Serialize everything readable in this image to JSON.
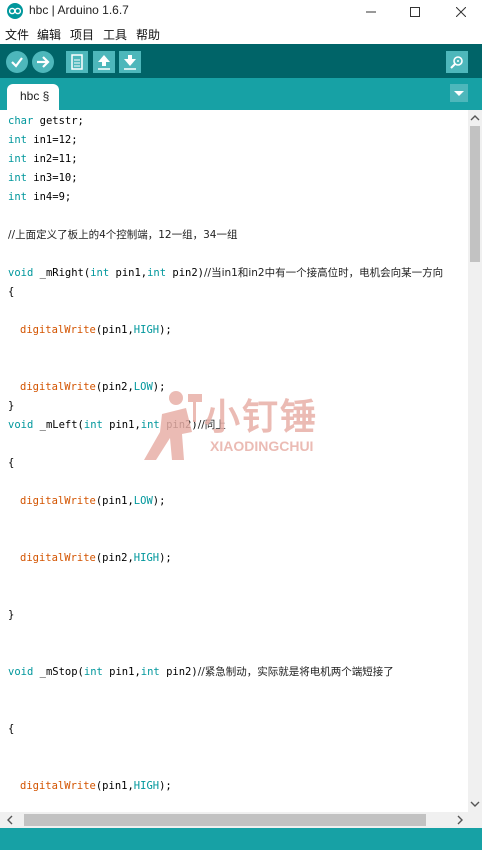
{
  "window": {
    "title": "hbc | Arduino 1.6.7",
    "minimize_icon": "minimize-icon",
    "maximize_icon": "maximize-icon",
    "close_icon": "close-icon"
  },
  "menu": {
    "items": [
      "文件",
      "编辑",
      "项目",
      "工具",
      "帮助"
    ]
  },
  "toolbar": {
    "buttons": [
      "verify-icon",
      "upload-icon",
      "new-icon",
      "open-icon",
      "save-icon"
    ],
    "serial_monitor": "serial-monitor-icon"
  },
  "tabs": [
    {
      "label": "hbc §"
    }
  ],
  "code": {
    "l1_kw": "char",
    "l1_rest": " getstr;",
    "l2_kw": "int",
    "l2_rest": " in1=12;",
    "l3_kw": "int",
    "l3_rest": " in2=11;",
    "l4_kw": "int",
    "l4_rest": " in3=10;",
    "l5_kw": "int",
    "l5_rest": " in4=9;",
    "l6": "//上面定义了板上的4个控制端，12一组，34一组",
    "l7_void": "void",
    "l7_name": " _mRight(",
    "l7_int1": "int",
    "l7_p1": " pin1,",
    "l7_int2": "int",
    "l7_p2": " pin2)",
    "l7_cm": "//当in1和in2中有一个接高位时，电机会向某一方向",
    "l8": "{",
    "l9_fn": "digitalWrite",
    "l9_a": "(pin1,",
    "l9_c": "HIGH",
    "l9_e": ");",
    "l10_fn": "digitalWrite",
    "l10_a": "(pin2,",
    "l10_c": "LOW",
    "l10_e": ");",
    "l11": "}",
    "l12_void": "void",
    "l12_name": " _mLeft(",
    "l12_int1": "int",
    "l12_p1": " pin1,",
    "l12_int2": "int",
    "l12_p2": " pin2)",
    "l12_cm": "//同上",
    "l13": "{",
    "l14_fn": "digitalWrite",
    "l14_a": "(pin1,",
    "l14_c": "LOW",
    "l14_e": ");",
    "l15_fn": "digitalWrite",
    "l15_a": "(pin2,",
    "l15_c": "HIGH",
    "l15_e": ");",
    "l16": "}",
    "l17_void": "void",
    "l17_name": " _mStop(",
    "l17_int1": "int",
    "l17_p1": " pin1,",
    "l17_int2": "int",
    "l17_p2": " pin2)",
    "l17_cm": "//紧急制动，实际就是将电机两个端短接了",
    "l18": "{",
    "l19_fn": "digitalWrite",
    "l19_a": "(pin1,",
    "l19_c": "HIGH",
    "l19_e": ");"
  },
  "watermark": {
    "big": "小钉锤",
    "small": "XIAODINGCHUI"
  },
  "colors": {
    "toolbar": "#006468",
    "tabbar": "#17a1a5",
    "button": "#4db7bb",
    "keyword": "#00979c",
    "function": "#d35400"
  }
}
